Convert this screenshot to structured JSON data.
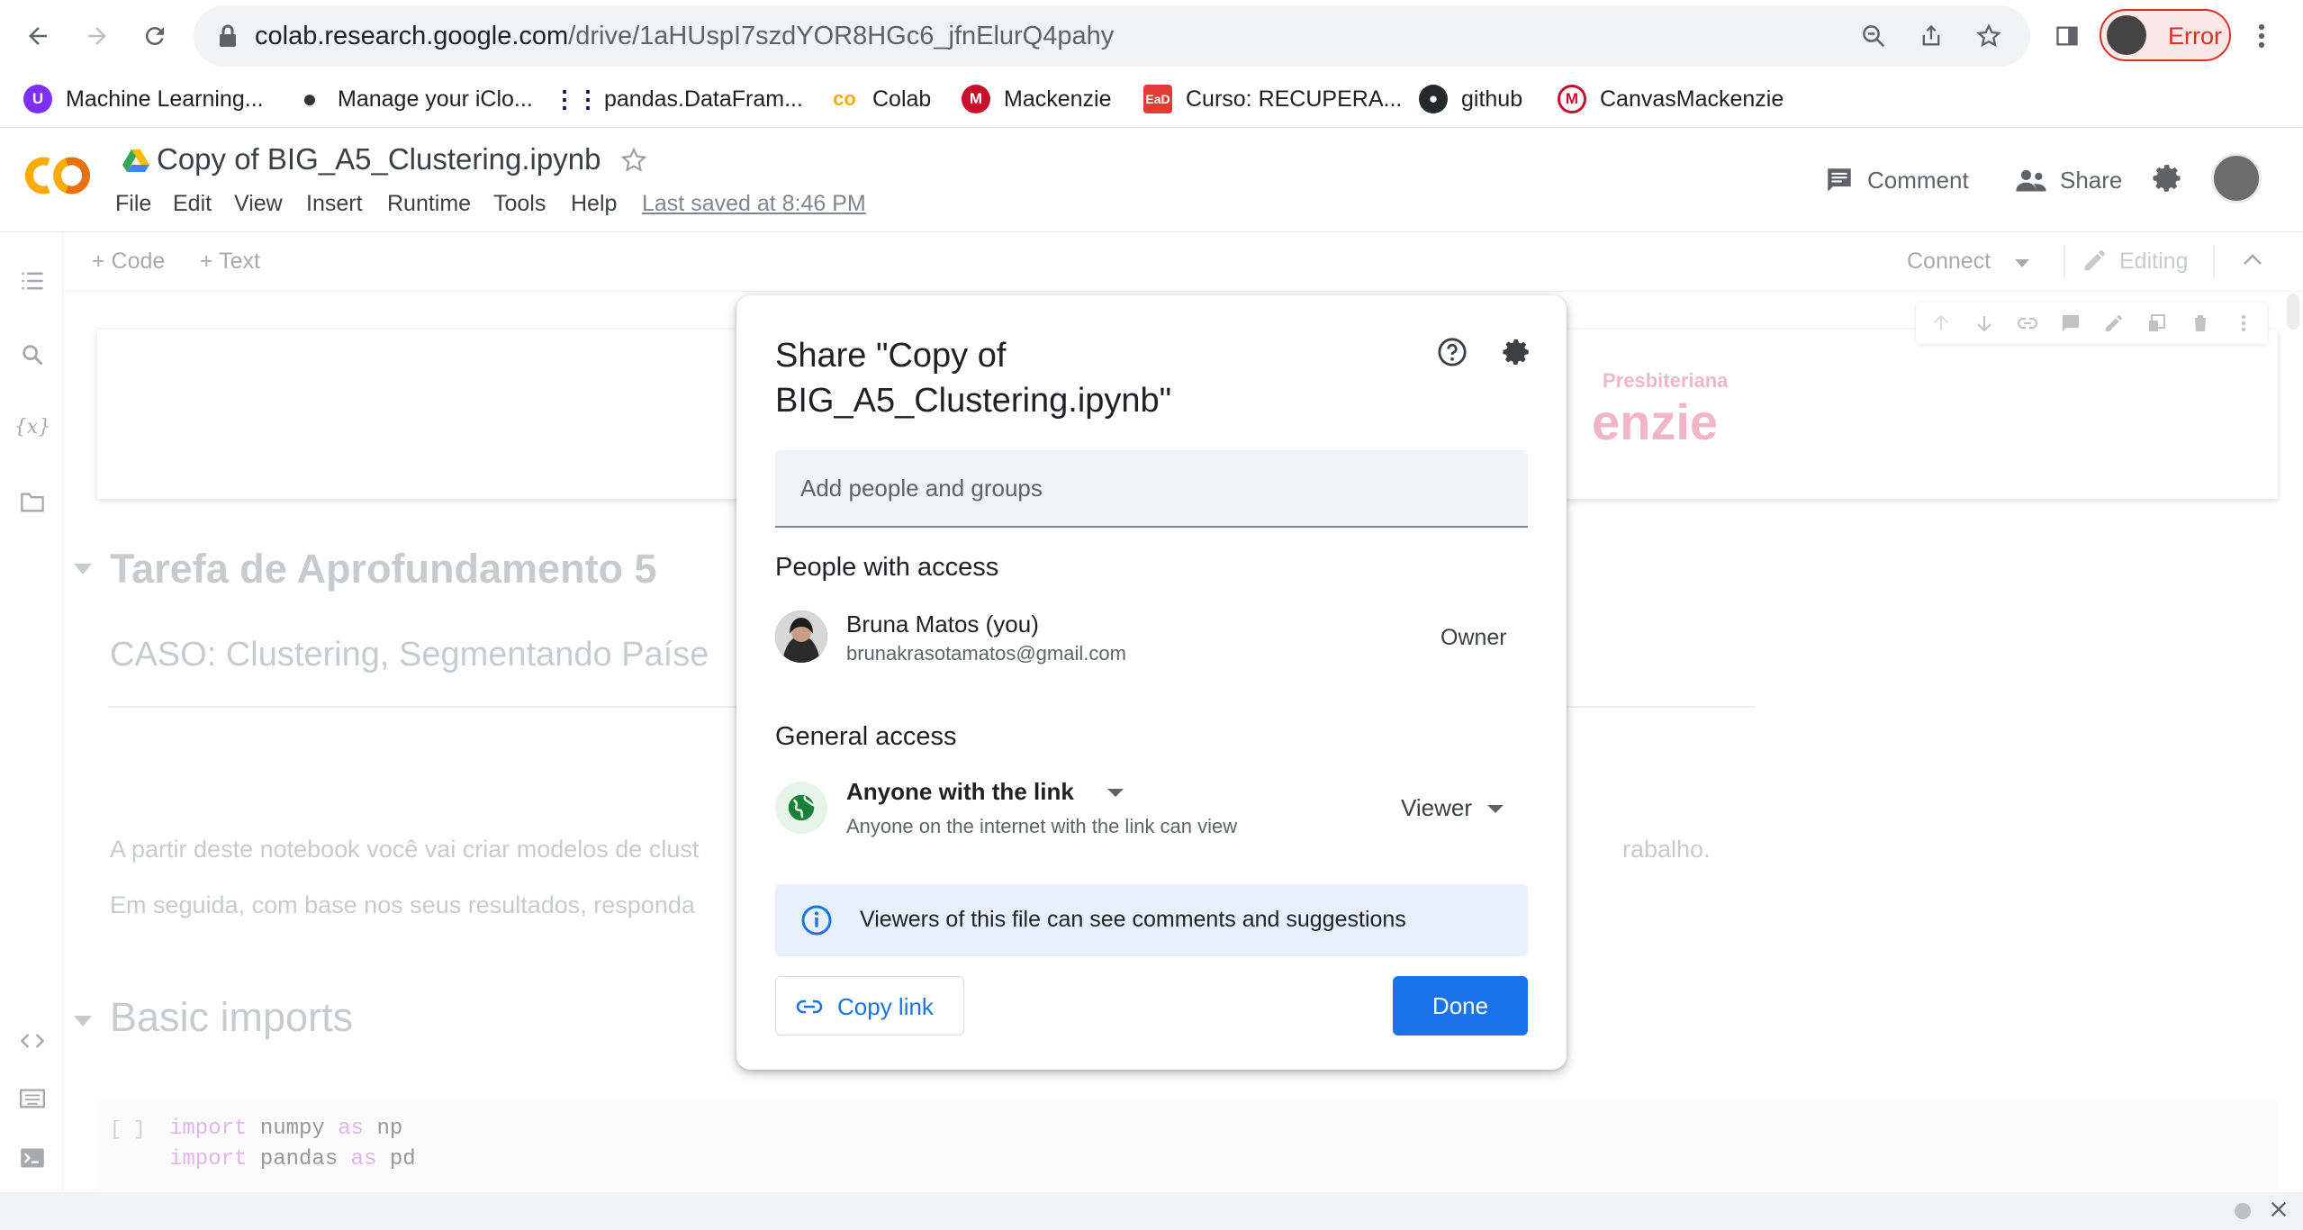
{
  "browser": {
    "url_host": "colab.research.google.com",
    "url_path": "/drive/1aHUspI7szdYOR8HGc6_jfnElurQ4pahy",
    "profile_status": "Error"
  },
  "bookmarks": [
    {
      "label": "Machine Learning...",
      "icon": "purple-u-icon",
      "color": "#7b2ff7"
    },
    {
      "label": "Manage your iClo...",
      "icon": "apple-icon",
      "color": "#333333"
    },
    {
      "label": "pandas.DataFram...",
      "icon": "pandas-icon",
      "color": "#150458"
    },
    {
      "label": "Colab",
      "icon": "colab-icon",
      "color": "#f9ab00"
    },
    {
      "label": "Mackenzie",
      "icon": "mackenzie-icon",
      "color": "#c8102e"
    },
    {
      "label": "Curso: RECUPERA...",
      "icon": "ead-icon",
      "color": "#e53935"
    },
    {
      "label": "github",
      "icon": "github-icon",
      "color": "#24292e"
    },
    {
      "label": "CanvasMackenzie",
      "icon": "canvas-icon",
      "color": "#c8102e"
    }
  ],
  "colab": {
    "title": "Copy of BIG_A5_Clustering.ipynb",
    "menu": [
      "File",
      "Edit",
      "View",
      "Insert",
      "Runtime",
      "Tools",
      "Help"
    ],
    "last_saved": "Last saved at 8:46 PM",
    "comment": "Comment",
    "share": "Share",
    "add_code": "+ Code",
    "add_text": "+ Text",
    "connect": "Connect",
    "editing": "Editing"
  },
  "notebook": {
    "logo_small": "Presbiteriana",
    "logo_big": "enzie",
    "heading1": "Tarefa de Aprofundamento 5",
    "heading2": "CASO: Clustering, Segmentando Paíse",
    "para1": "A partir deste notebook você vai criar modelos de clust",
    "para1_end": "rabalho.",
    "para2": "Em seguida, com base nos seus resultados, responda",
    "heading_basic": "Basic imports",
    "code_bracket": "[ ]",
    "code_lines": [
      {
        "kw": "import",
        "mid": " numpy ",
        "kw2": "as",
        "end": " np"
      },
      {
        "kw": "import",
        "mid": " pandas ",
        "kw2": "as",
        "end": " pd"
      }
    ]
  },
  "dialog": {
    "title": "Share \"Copy of BIG_A5_Clustering.ipynb\"",
    "add_placeholder": "Add people and groups",
    "people_heading": "People with access",
    "owner_name": "Bruna Matos (you)",
    "owner_email": "brunakrasotamatos@gmail.com",
    "owner_role": "Owner",
    "general_heading": "General access",
    "access_type": "Anyone with the link",
    "access_desc": "Anyone on the internet with the link can view",
    "role": "Viewer",
    "info": "Viewers of this file can see comments and suggestions",
    "copy_link": "Copy link",
    "done": "Done"
  },
  "colors": {
    "accent": "#1a73e8",
    "error": "#d93025",
    "globe_green": "#188038"
  }
}
